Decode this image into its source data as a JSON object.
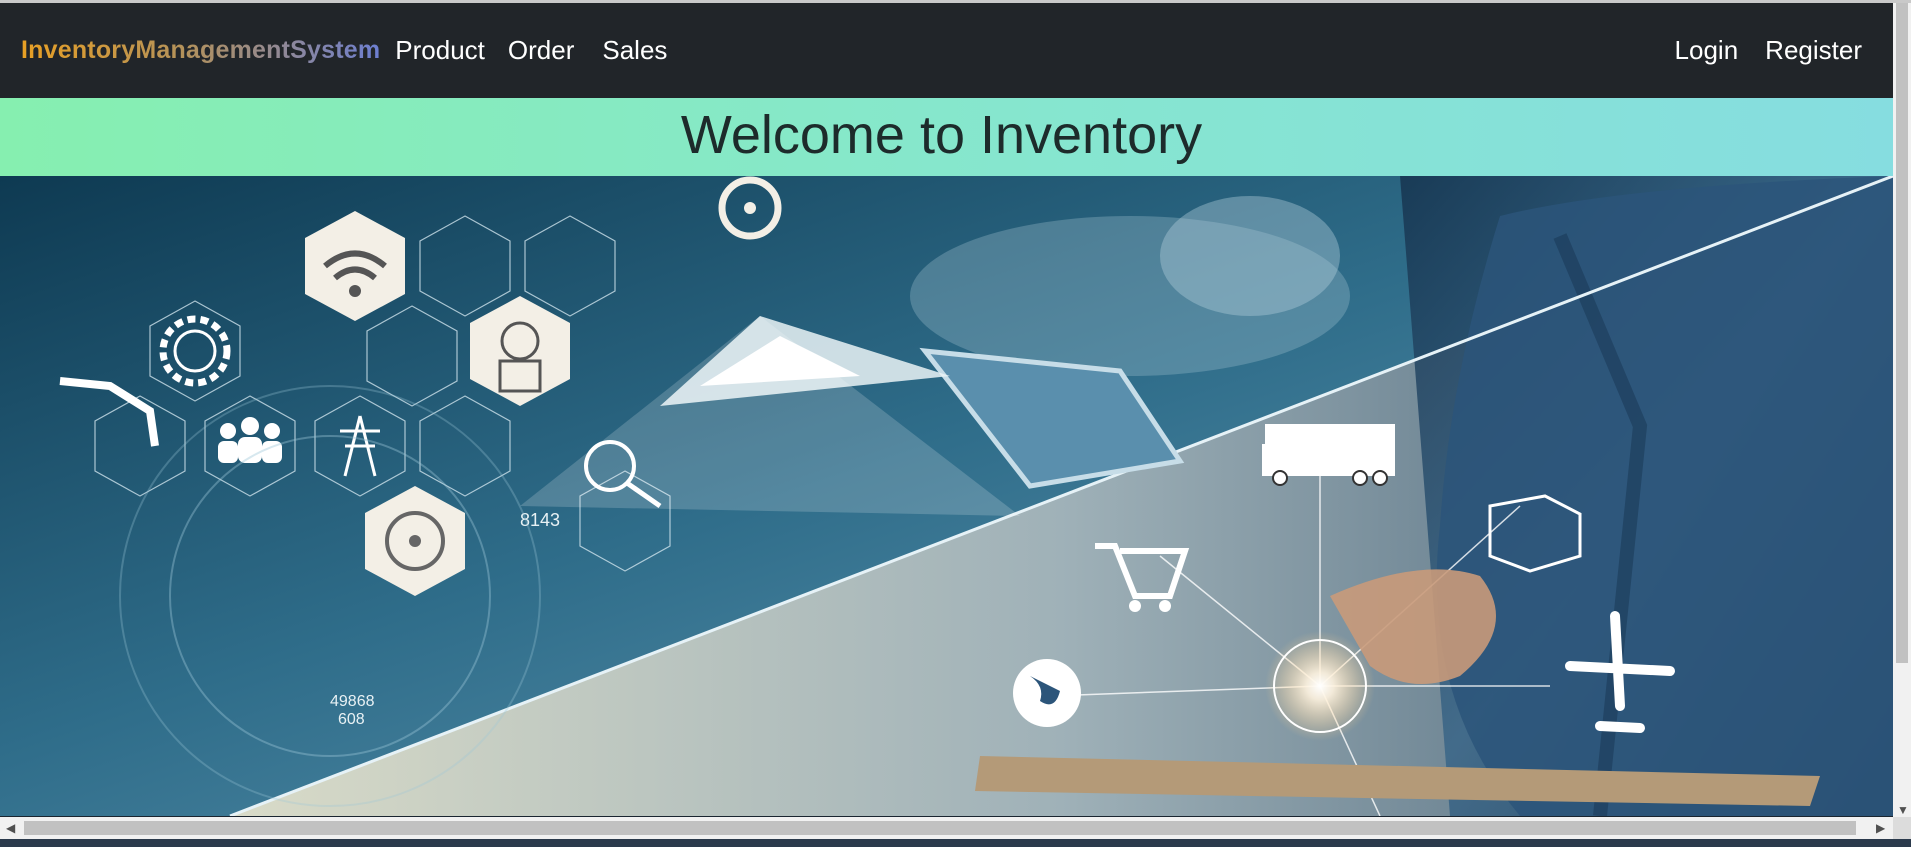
{
  "navbar": {
    "brand": "InventoryManagementSystem",
    "links": [
      "Product",
      "Order",
      "Sales"
    ],
    "right_links": [
      "Login",
      "Register"
    ]
  },
  "hero": {
    "heading": "Welcome to Inventory",
    "labels": {
      "code1": "8143",
      "code2": "49868",
      "code3": "608"
    }
  },
  "colors": {
    "navbar_bg": "#212529",
    "banner_start": "#86efb0",
    "banner_end": "#86dde0"
  }
}
